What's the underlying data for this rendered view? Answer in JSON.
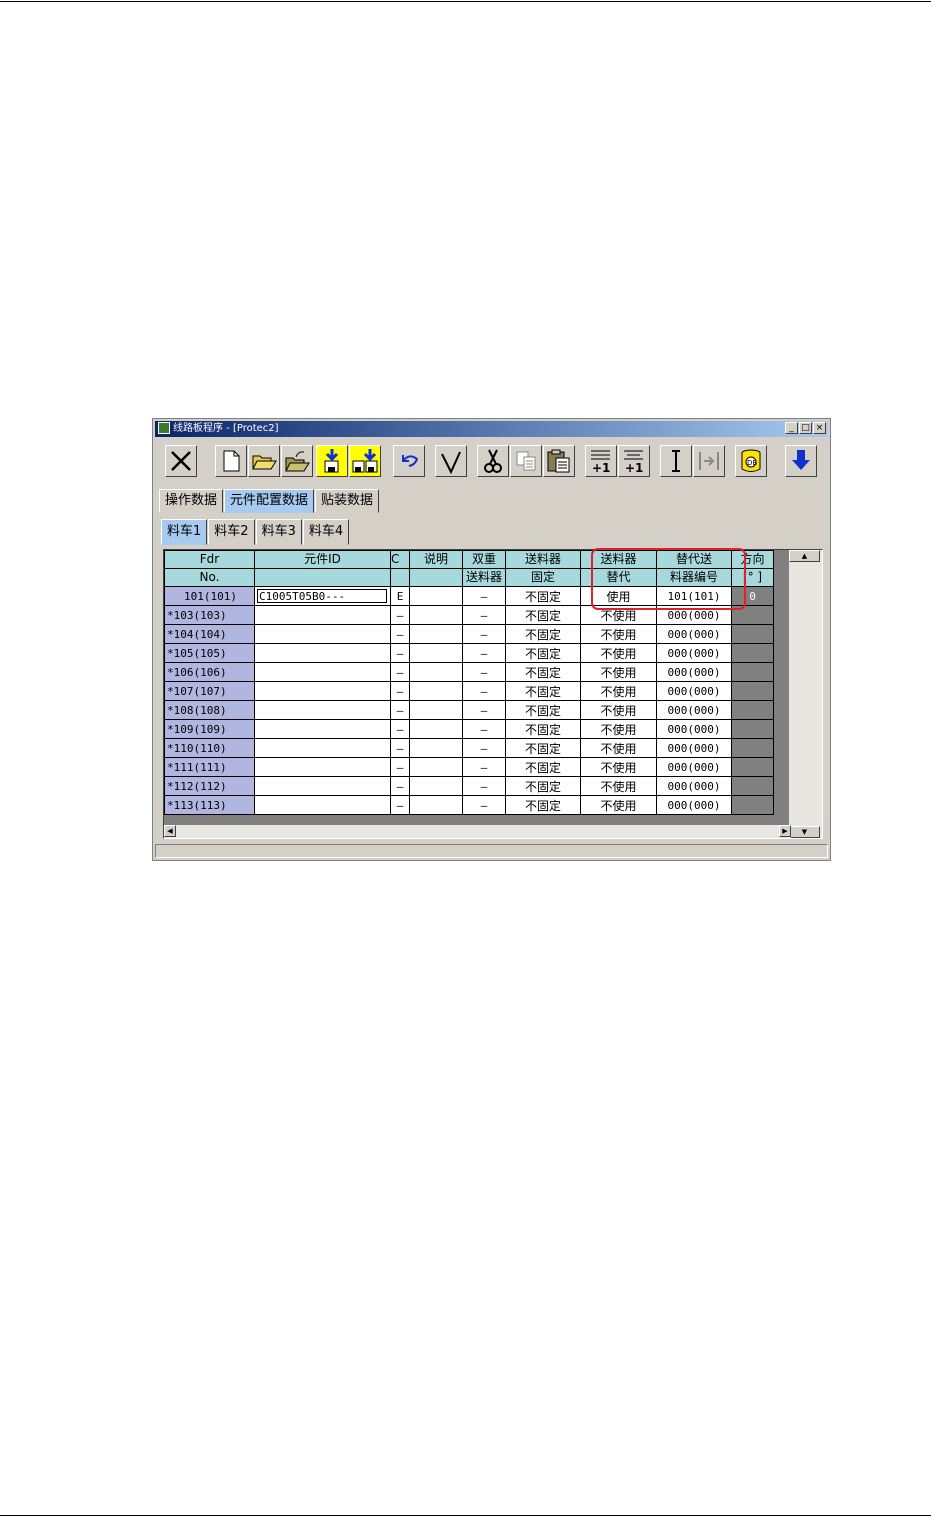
{
  "window": {
    "title": "线路板程序 - [Protec2]",
    "controls": [
      "_",
      "□",
      "×"
    ]
  },
  "tabs_main": [
    {
      "label": "操作数据",
      "active": false
    },
    {
      "label": "元件配置数据",
      "active": true
    },
    {
      "label": "贴装数据",
      "active": false
    }
  ],
  "tabs_cart": [
    {
      "label": "料车1",
      "active": true
    },
    {
      "label": "料车2",
      "active": false
    },
    {
      "label": "料车3",
      "active": false
    },
    {
      "label": "料车4",
      "active": false
    }
  ],
  "table": {
    "headers": [
      {
        "l1": "Fdr",
        "l2": "No."
      },
      {
        "l1": "元件ID",
        "l2": ""
      },
      {
        "l1": "C",
        "l2": ""
      },
      {
        "l1": "说明",
        "l2": ""
      },
      {
        "l1": "双重",
        "l2": "送料器"
      },
      {
        "l1": "送料器",
        "l2": "固定"
      },
      {
        "l1": "送料器",
        "l2": "替代"
      },
      {
        "l1": "替代送",
        "l2": "料器编号"
      },
      {
        "l1": "方向",
        "l2": "[° ]"
      }
    ],
    "rows": [
      {
        "fdr": "101(101)",
        "part": "C1005T05B0---",
        "c": "E",
        "desc": "",
        "dual": "–",
        "fixed": "不固定",
        "sub": "使用",
        "subno": "101(101)",
        "dir": "0"
      },
      {
        "fdr": "*103(103)",
        "part": "",
        "c": "–",
        "desc": "",
        "dual": "–",
        "fixed": "不固定",
        "sub": "不使用",
        "subno": "000(000)",
        "dir": ""
      },
      {
        "fdr": "*104(104)",
        "part": "",
        "c": "–",
        "desc": "",
        "dual": "–",
        "fixed": "不固定",
        "sub": "不使用",
        "subno": "000(000)",
        "dir": ""
      },
      {
        "fdr": "*105(105)",
        "part": "",
        "c": "–",
        "desc": "",
        "dual": "–",
        "fixed": "不固定",
        "sub": "不使用",
        "subno": "000(000)",
        "dir": ""
      },
      {
        "fdr": "*106(106)",
        "part": "",
        "c": "–",
        "desc": "",
        "dual": "–",
        "fixed": "不固定",
        "sub": "不使用",
        "subno": "000(000)",
        "dir": ""
      },
      {
        "fdr": "*107(107)",
        "part": "",
        "c": "–",
        "desc": "",
        "dual": "–",
        "fixed": "不固定",
        "sub": "不使用",
        "subno": "000(000)",
        "dir": ""
      },
      {
        "fdr": "*108(108)",
        "part": "",
        "c": "–",
        "desc": "",
        "dual": "–",
        "fixed": "不固定",
        "sub": "不使用",
        "subno": "000(000)",
        "dir": ""
      },
      {
        "fdr": "*109(109)",
        "part": "",
        "c": "–",
        "desc": "",
        "dual": "–",
        "fixed": "不固定",
        "sub": "不使用",
        "subno": "000(000)",
        "dir": ""
      },
      {
        "fdr": "*110(110)",
        "part": "",
        "c": "–",
        "desc": "",
        "dual": "–",
        "fixed": "不固定",
        "sub": "不使用",
        "subno": "000(000)",
        "dir": ""
      },
      {
        "fdr": "*111(111)",
        "part": "",
        "c": "–",
        "desc": "",
        "dual": "–",
        "fixed": "不固定",
        "sub": "不使用",
        "subno": "000(000)",
        "dir": ""
      },
      {
        "fdr": "*112(112)",
        "part": "",
        "c": "–",
        "desc": "",
        "dual": "–",
        "fixed": "不固定",
        "sub": "不使用",
        "subno": "000(000)",
        "dir": ""
      },
      {
        "fdr": "*113(113)",
        "part": "",
        "c": "–",
        "desc": "",
        "dual": "–",
        "fixed": "不固定",
        "sub": "不使用",
        "subno": "000(000)",
        "dir": ""
      }
    ]
  },
  "toolbar_icons": [
    "close-x-icon",
    "new-file-icon",
    "open-folder-icon",
    "open-folder-arrow-icon",
    "save-icon",
    "save-all-icon",
    "undo-icon",
    "check-icon",
    "cut-icon",
    "copy-icon",
    "paste-icon",
    "increment-insert-icon",
    "increment-icon",
    "text-cursor-icon",
    "jump-icon",
    "database-icon",
    "download-arrow-icon"
  ]
}
